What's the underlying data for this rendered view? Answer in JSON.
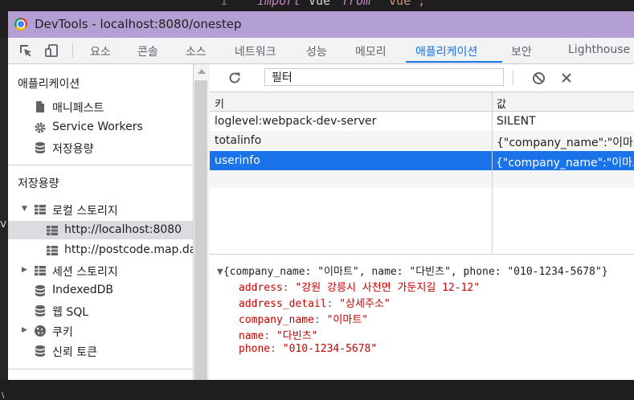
{
  "editor": {
    "line_number": "1",
    "keyword": "import",
    "identifier": "Vue",
    "from_keyword": "from",
    "module": "\"vue\";",
    "side_v": "v",
    "side_a": "\\"
  },
  "window": {
    "title": "DevTools - localhost:8080/onestep"
  },
  "tabs": [
    {
      "label": "요소"
    },
    {
      "label": "콘솔"
    },
    {
      "label": "소스"
    },
    {
      "label": "네트워크"
    },
    {
      "label": "성능"
    },
    {
      "label": "메모리"
    },
    {
      "label": "애플리케이션",
      "active": true
    },
    {
      "label": "보안"
    },
    {
      "label": "Lighthouse"
    }
  ],
  "sidebar": {
    "application_header": "애플리케이션",
    "application_items": [
      {
        "label": "매니페스트",
        "icon": "document-icon"
      },
      {
        "label": "Service Workers",
        "icon": "gear-icon"
      },
      {
        "label": "저장용량",
        "icon": "database-icon"
      }
    ],
    "storage_header": "저장용량",
    "storage_items": [
      {
        "label": "로컬 스토리지",
        "icon": "grid-icon",
        "expanded": true
      },
      {
        "label": "http://localhost:8080",
        "icon": "grid-icon",
        "selected": true
      },
      {
        "label": "http://postcode.map.daum.net",
        "icon": "grid-icon"
      },
      {
        "label": "세션 스토리지",
        "icon": "grid-icon",
        "expanded": false
      },
      {
        "label": "IndexedDB",
        "icon": "database-icon"
      },
      {
        "label": "웹 SQL",
        "icon": "database-icon"
      },
      {
        "label": "쿠키",
        "icon": "cookie-icon",
        "expanded": false
      },
      {
        "label": "신뢰 토큰",
        "icon": "database-icon"
      }
    ]
  },
  "toolbar": {
    "filter_placeholder": "필터"
  },
  "table": {
    "headers": [
      "키",
      "값"
    ],
    "rows": [
      {
        "key": "loglevel:webpack-dev-server",
        "value": "SILENT"
      },
      {
        "key": "totalinfo",
        "value": "{\"company_name\":\"이마트\"..."
      },
      {
        "key": "userinfo",
        "value": "{\"company_name\":\"이마트\"...",
        "selected": true
      }
    ]
  },
  "preview": {
    "summary": "{company_name: \"이마트\", name: \"다빈츠\", phone: \"010-1234-5678\"}",
    "fields": [
      {
        "key": "address",
        "value": "\"강원 강릉시 사천면 가둔지길 12-12\""
      },
      {
        "key": "address_detail",
        "value": "\"상세주소\""
      },
      {
        "key": "company_name",
        "value": "\"이마트\""
      },
      {
        "key": "name",
        "value": "\"다빈츠\""
      },
      {
        "key": "phone",
        "value": "\"010-1234-5678\""
      }
    ]
  },
  "colors": {
    "accent": "#1a73e8",
    "titlebar": "#b49fd4",
    "preview_value": "#c80000"
  }
}
